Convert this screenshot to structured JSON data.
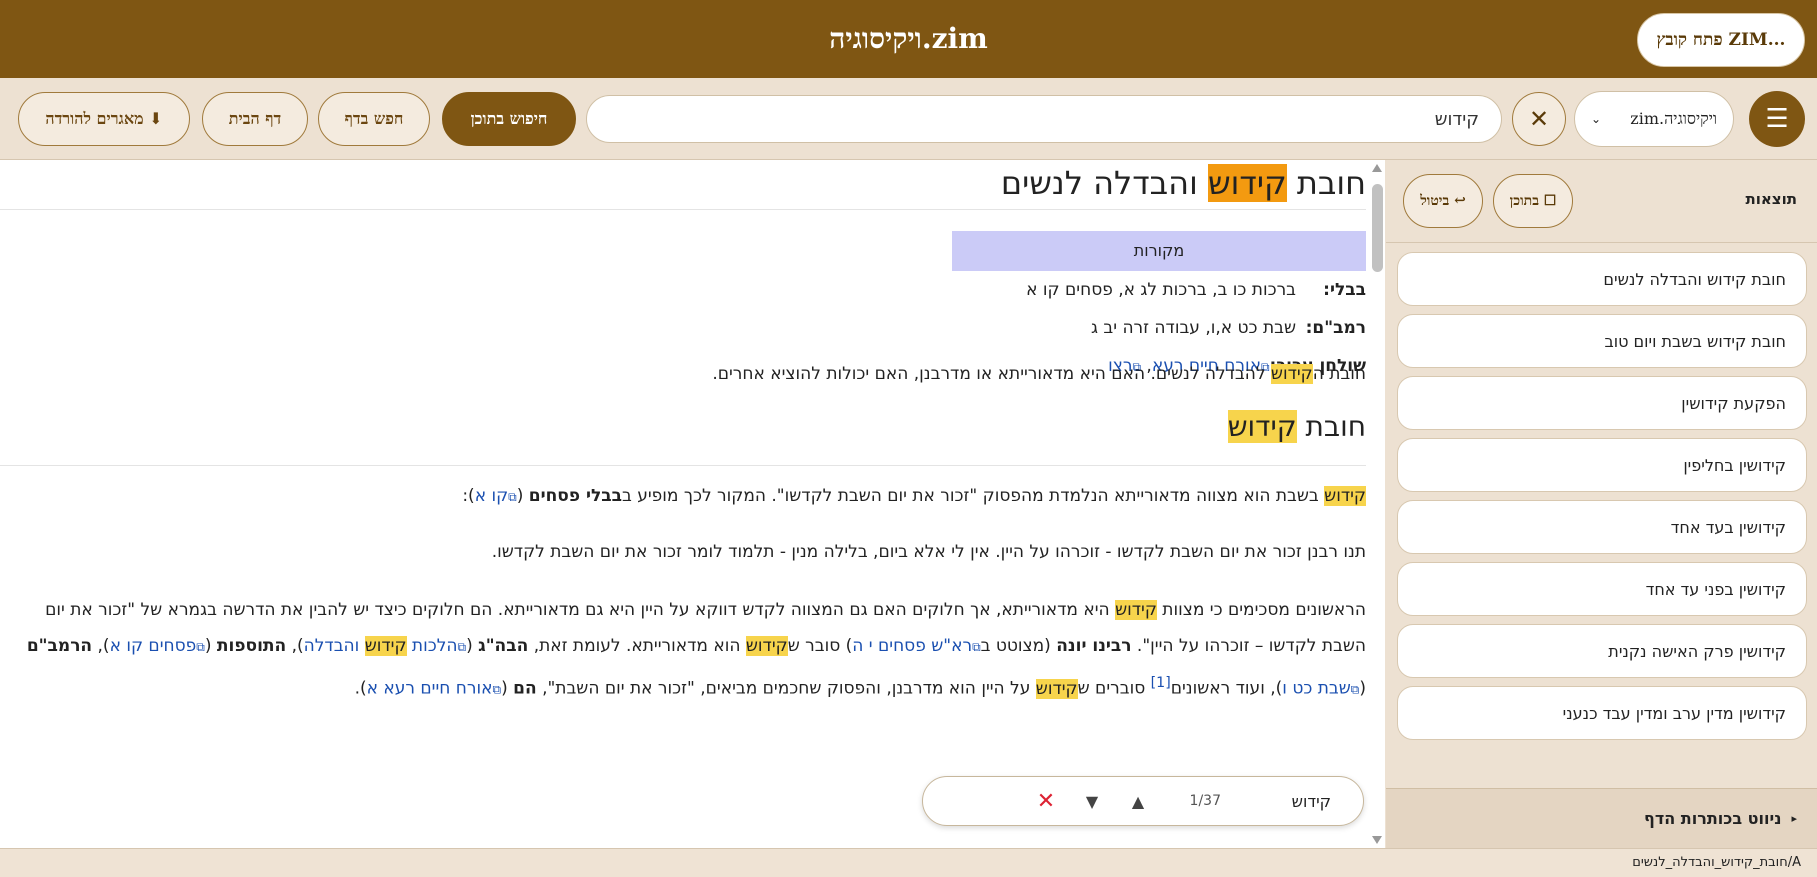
{
  "app": {
    "title": "ויקיסוגיה.zim",
    "open_file_label": "פתח קובץ ZIM..."
  },
  "toolbar": {
    "menu_icon": "☰",
    "book_select": "ויקיסוגיה.zim",
    "clear_icon": "✕",
    "search_value": "קידוש",
    "content_search_label": "חיפוש בתוכן",
    "find_in_page_label": "חפש בדף",
    "home_label": "דף הבית",
    "download_label": "מאגרים להורדה ⬇"
  },
  "article": {
    "title_pre": "חובת ",
    "title_hl": "קידוש",
    "title_post": " והבדלה לנשים",
    "infobox": {
      "header": "מקורות",
      "rows": [
        {
          "label": "בבלי:",
          "value": "ברכות כו ב, ברכות לג א, פסחים קו א"
        },
        {
          "label": "רמב\"ם:",
          "value": "שבת כט א,ו, עבודה זרה יב ג"
        }
      ],
      "shulchan_label": "שולחן ערוך:",
      "shulchan_link1": "אורח חיים רעא",
      "shulchan_sep": ", ",
      "shulchan_link2": "רצו"
    },
    "intro_pre": "חובת ה",
    "intro_hl": "קידוש",
    "intro_post": " להבדלה לנשים. האם היא מדאורייתא או מדרבנן, האם יכולות להוציא אחרים.",
    "h2_pre": "חובת ",
    "h2_hl": "קידוש",
    "p1_hl": "קידוש",
    "p1_text": " בשבת הוא מצווה מדאורייתא הנלמדת מהפסוק \"זכור את יום השבת לקדשו\". המקור לכך מופיע ב",
    "p1_bold": "בבלי פסחים",
    "p1_link": "קו א",
    "p1_end": "):",
    "p2": "תנו רבנן זכור את יום השבת לקדשו - זוכרהו על היין. אין לי אלא ביום, בלילה מנין - תלמוד לומר זכור את יום השבת לקדשו.",
    "p3_a": "הראשונים מסכימים כי מצוות ",
    "p3_hl1": "קידוש",
    "p3_b": " היא מדאורייתא, אך חלוקים האם גם המצווה לקדש דווקא על היין היא גם מדאורייתא. הם חלוקים כיצד יש להבין את הדרשה בגמרא של \"זכור את יום השבת לקדשו – זוכרהו על היין\". ",
    "p3_bold1": "רבינו יונה",
    "p3_c": " (מצוטט ב",
    "p3_link1": "רא\"ש פסחים י ה",
    "p3_d": ") סובר ש",
    "p3_hl2": "קידוש",
    "p3_e": " הוא מדאורייתא. לעומת זאת, ",
    "p3_bold2": "הבה\"ג",
    "p3_f": " (",
    "p3_link2": "הלכות ",
    "p3_hl3": "קידוש",
    "p3_link3": " והבדלה",
    "p3_g": "), ",
    "p3_bold3": "התוספות",
    "p3_h": " (",
    "p3_link4": "פסחים קו א",
    "p3_i": "), ",
    "p3_bold4": "הרמב\"ם",
    "p3_j": " (",
    "p3_link5": "שבת כט ו",
    "p3_k": "), ועוד ראשונים",
    "p3_sup": "[1]",
    "p3_l": " סוברים ש",
    "p3_hl4": "קידוש",
    "p3_m": " על היין הוא מדרבנן, והפסוק שחכמים מביאים, \"זכור את יום השבת\",",
    "p4_tail_bold": "הם",
    "p4_tail_a": " (",
    "p4_tail_link": "אורח חיים רעא א",
    "p4_tail_b": ")."
  },
  "findbar": {
    "query": "קידוש",
    "counter": "1/37",
    "prev_icon": "▲",
    "next_icon": "▼",
    "close_icon": "✕"
  },
  "sidebar": {
    "results_label": "תוצאות",
    "in_content_label": "☐ בתוכן",
    "cancel_label": "↩ ביטול",
    "results": [
      "חובת קידוש והבדלה לנשים",
      "חובת קידוש בשבת ויום טוב",
      "הפקעת קידושין",
      "קידושין בחליפין",
      "קידושין בעד אחד",
      "קידושין בפני עד אחד",
      "קידושין פרק האישה נקנית",
      "קידושין מדין ערב ומדין עבד כנעני"
    ],
    "nav_headings_label": "ניווט בכותרות הדף",
    "nav_arrow": "▸"
  },
  "status": {
    "path": "A/חובת_קידוש_והבדלה_לנשים"
  }
}
